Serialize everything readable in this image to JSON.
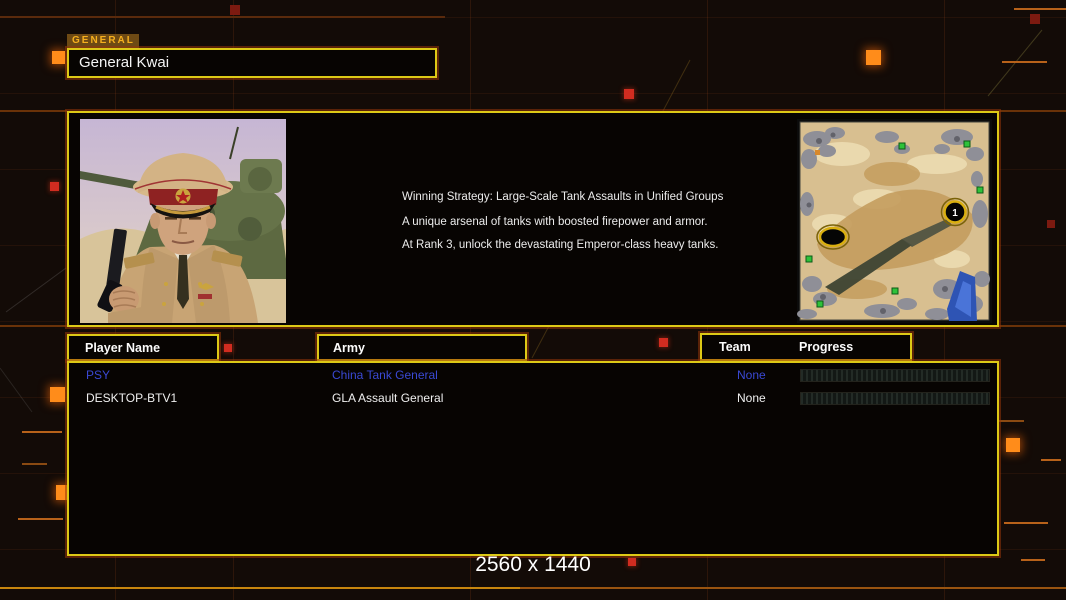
{
  "window": {
    "resolution_label": "2560 x 1440"
  },
  "header": {
    "tab_label": "GENERAL",
    "selected_general": "General Kwai"
  },
  "general_info": {
    "strategy_lines": [
      "Winning Strategy: Large-Scale Tank Assaults in Unified Groups",
      "A unique arsenal of tanks with boosted firepower and armor.",
      "At Rank 3, unlock the devastating Emperor-class heavy tanks."
    ]
  },
  "map_preview": {
    "start_marker_label": "1"
  },
  "player_table": {
    "headers": {
      "player_name": "Player Name",
      "army": "Army",
      "team": "Team",
      "progress": "Progress"
    },
    "rows": [
      {
        "player_name": "PSY",
        "army": "China Tank General",
        "team": "None",
        "progress_percent": 0,
        "text_color": "#3a49d4"
      },
      {
        "player_name": "DESKTOP-BTV1",
        "army": "GLA Assault General",
        "team": "None",
        "progress_percent": 0,
        "text_color": "#f0f0f0"
      }
    ]
  },
  "colors": {
    "panel_border": "#ddc916",
    "accent_orange": "#ff8c1a",
    "accent_red": "#d02c20",
    "link_blue": "#3a49d4",
    "background": "#130b07"
  }
}
